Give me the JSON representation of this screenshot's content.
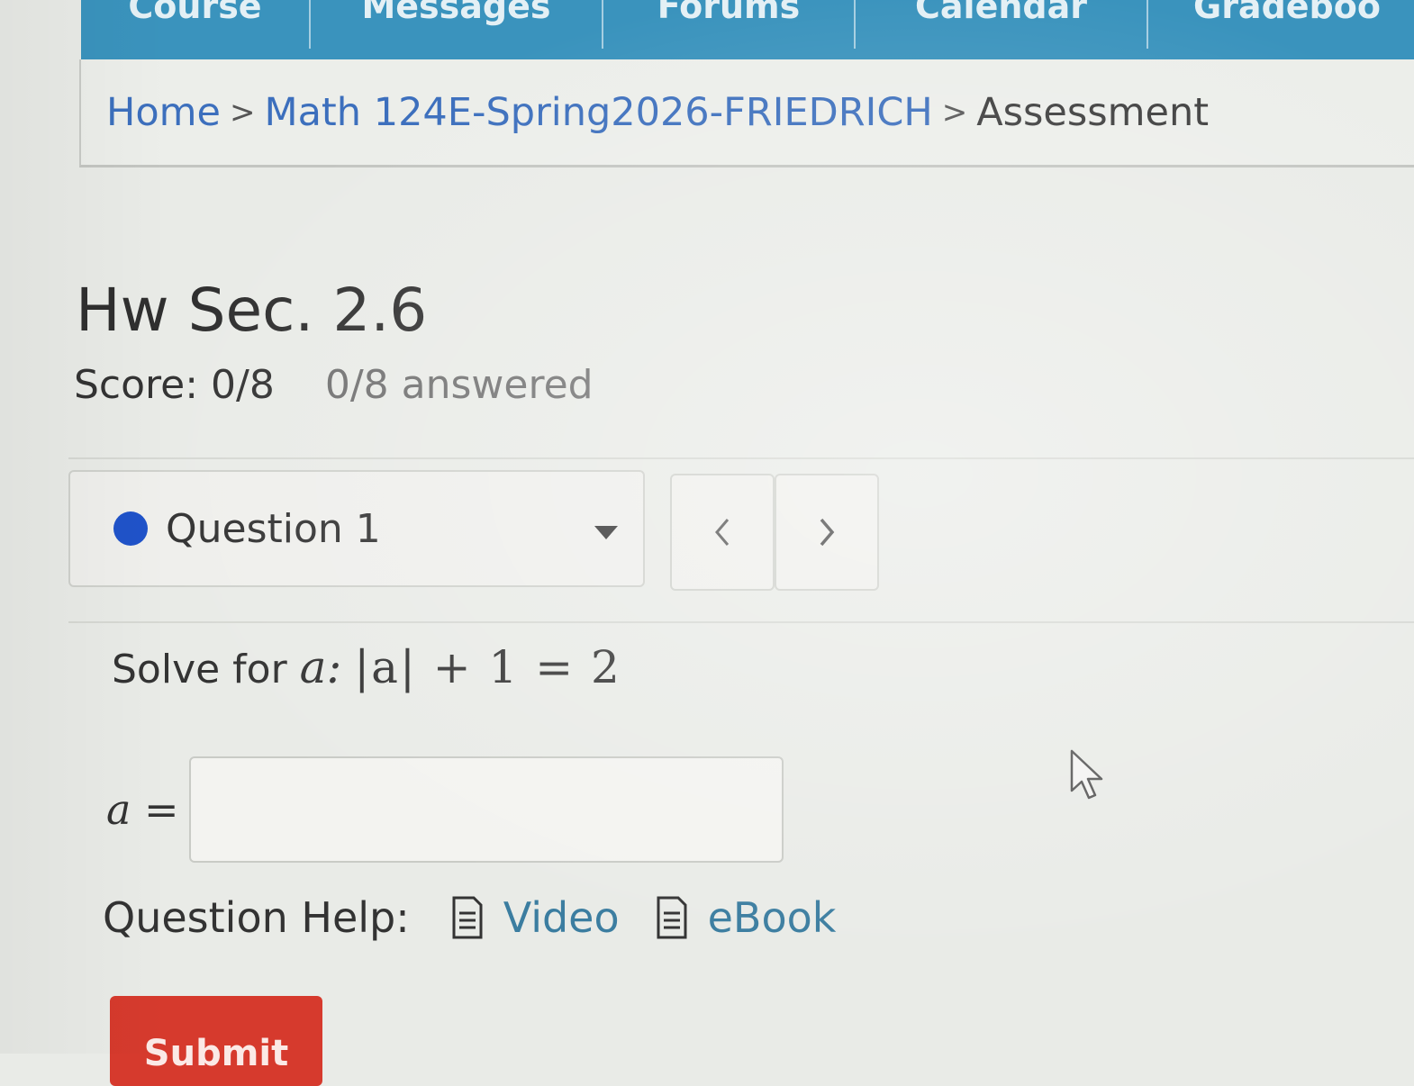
{
  "nav": {
    "tabs": [
      "Course",
      "Messages",
      "Forums",
      "Calendar",
      "Gradeboo"
    ],
    "accent_color": "#3a93bd"
  },
  "breadcrumb": {
    "home": "Home",
    "course": "Math 124E-Spring2026-FRIEDRICH",
    "current": "Assessment",
    "separator": ">"
  },
  "assessment": {
    "title": "Hw Sec. 2.6",
    "score": "Score: 0/8",
    "answered": "0/8 answered"
  },
  "question_nav": {
    "selected": "Question 1",
    "status_color": "#1f53c9",
    "prev_icon": "chevron-left-icon",
    "next_icon": "chevron-right-icon"
  },
  "question": {
    "prompt": "Solve for",
    "variable": "a:",
    "equation": "|a| + 1 = 2",
    "answer_label": "a =",
    "answer_value": ""
  },
  "help": {
    "label": "Question Help:",
    "video": "Video",
    "ebook": "eBook",
    "icon": "document-icon"
  },
  "actions": {
    "submit": "Submit",
    "submit_color": "#d63a2d"
  }
}
